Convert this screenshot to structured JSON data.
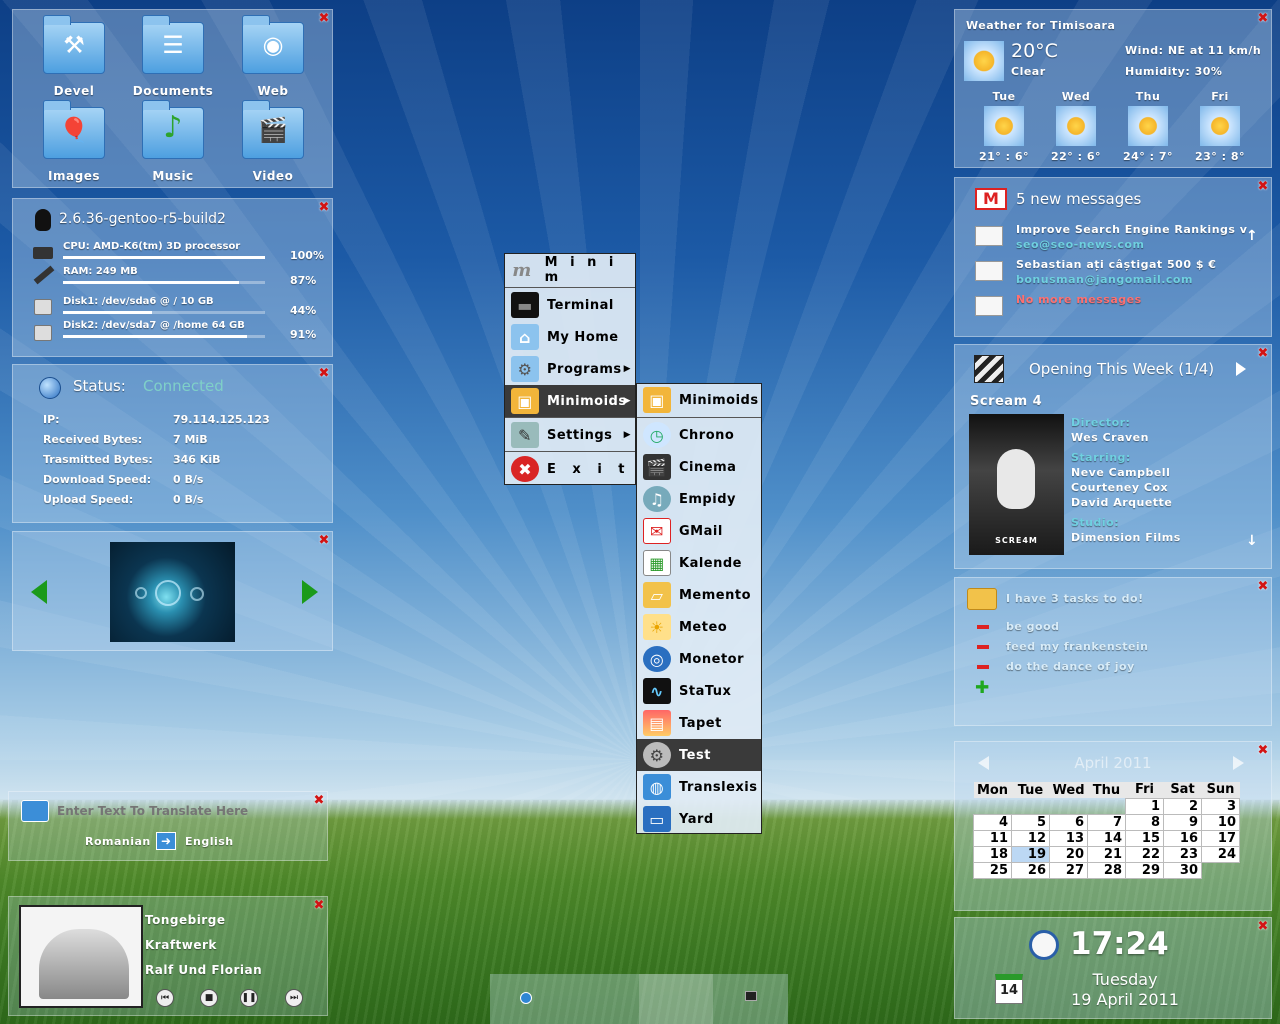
{
  "folders": [
    {
      "label": "Devel",
      "icon": "hammer-icon",
      "glyph": "⚒"
    },
    {
      "label": "Documents",
      "icon": "documents-icon",
      "glyph": "☰"
    },
    {
      "label": "Web",
      "icon": "web-icon",
      "glyph": "◉"
    },
    {
      "label": "Images",
      "icon": "images-icon",
      "glyph": "🎈"
    },
    {
      "label": "Music",
      "icon": "music-note-icon",
      "glyph": "♪"
    },
    {
      "label": "Video",
      "icon": "clapperboard-icon",
      "glyph": "🎬"
    }
  ],
  "sysinfo": {
    "kernel": "2.6.36-gentoo-r5-build2",
    "rows": [
      {
        "label": "CPU: AMD-K6(tm) 3D processor",
        "pct": "100%",
        "fill": 1.0,
        "icon": "cpu-icon"
      },
      {
        "label": "RAM: 249 MB",
        "pct": "87%",
        "fill": 0.87,
        "icon": "ram-icon"
      },
      {
        "label": "Disk1: /dev/sda6 @ / 10 GB",
        "pct": "44%",
        "fill": 0.44,
        "icon": "disk-icon"
      },
      {
        "label": "Disk2: /dev/sda7 @ /home 64 GB",
        "pct": "91%",
        "fill": 0.91,
        "icon": "disk-icon"
      }
    ]
  },
  "network": {
    "status_label": "Status:",
    "status_value": "Connected",
    "rows": [
      {
        "k": "IP:",
        "v": "79.114.125.123"
      },
      {
        "k": "Received Bytes:",
        "v": "7 MiB"
      },
      {
        "k": "Trasmitted Bytes:",
        "v": "346 KiB"
      },
      {
        "k": "Download Speed:",
        "v": "0 B/s"
      },
      {
        "k": "Upload Speed:",
        "v": "0 B/s"
      }
    ]
  },
  "translator": {
    "placeholder": "Enter Text To Translate Here",
    "from": "Romanian",
    "to": "English"
  },
  "player": {
    "title": "Tongebirge",
    "artist": "Kraftwerk",
    "album": "Ralf Und Florian"
  },
  "menu": {
    "title": "M i n i m",
    "items": [
      {
        "label": "Terminal",
        "icon": "terminal-icon",
        "glyph": "▬"
      },
      {
        "label": "My Home",
        "icon": "home-icon",
        "glyph": "⌂"
      },
      {
        "label": "Programs",
        "icon": "programs-icon",
        "glyph": "⚙"
      },
      {
        "label": "Minimoids",
        "icon": "minimoids-icon",
        "glyph": "▣"
      },
      {
        "label": "Settings",
        "icon": "settings-icon",
        "glyph": "✎"
      },
      {
        "label": "E x i t",
        "icon": "exit-icon",
        "glyph": "✖"
      }
    ],
    "submenu_title": "Minimoids",
    "submenu": [
      {
        "label": "Chrono",
        "icon": "chrono-icon",
        "glyph": "◷"
      },
      {
        "label": "Cinema",
        "icon": "cinema-icon",
        "glyph": "🎬"
      },
      {
        "label": "Empidy",
        "icon": "empidy-icon",
        "glyph": "♫"
      },
      {
        "label": "GMail",
        "icon": "gmail-icon",
        "glyph": "✉"
      },
      {
        "label": "Kalende",
        "icon": "calendar-icon",
        "glyph": "▦"
      },
      {
        "label": "Memento",
        "icon": "memento-icon",
        "glyph": "▱"
      },
      {
        "label": "Meteo",
        "icon": "meteo-icon",
        "glyph": "☀"
      },
      {
        "label": "Monetor",
        "icon": "monetor-icon",
        "glyph": "◎"
      },
      {
        "label": "StaTux",
        "icon": "statux-icon",
        "glyph": "∿"
      },
      {
        "label": "Tapet",
        "icon": "tapet-icon",
        "glyph": "▤"
      },
      {
        "label": "Test",
        "icon": "gear-icon",
        "glyph": "⚙"
      },
      {
        "label": "Translexis",
        "icon": "translexis-icon",
        "glyph": "◍"
      },
      {
        "label": "Yard",
        "icon": "yard-icon",
        "glyph": "▭"
      }
    ]
  },
  "weather": {
    "title": "Weather for Timisoara",
    "temp": "20°C",
    "cond": "Clear",
    "wind": "Wind: NE at 11 km/h",
    "humidity": "Humidity: 30%",
    "days": [
      {
        "day": "Tue",
        "range": "21° : 6°",
        "icon": "sun-icon"
      },
      {
        "day": "Wed",
        "range": "22° : 6°",
        "icon": "sun-icon"
      },
      {
        "day": "Thu",
        "range": "24° : 7°",
        "icon": "sun-icon"
      },
      {
        "day": "Fri",
        "range": "23° : 8°",
        "icon": "partly-cloudy-icon"
      }
    ]
  },
  "mail": {
    "header": "5 new messages",
    "messages": [
      {
        "subject": "Improve Search Engine Rankings v",
        "from": "seo@seo-news.com"
      },
      {
        "subject": "Sebastian ați câștigat 500 $ €",
        "from": "bonusman@jangomail.com"
      }
    ],
    "none": "No more messages"
  },
  "cinema": {
    "header": "Opening This Week (1/4)",
    "movie": "Scream 4",
    "director_label": "Director:",
    "director": "Wes Craven",
    "starring_label": "Starring:",
    "cast": [
      "Neve Campbell",
      "Courteney Cox",
      "David Arquette"
    ],
    "studio_label": "Studio:",
    "studio": "Dimension Films",
    "poster_text": "SCRE4M"
  },
  "todo": {
    "header": "I have 3 tasks to do!",
    "tasks": [
      "be good",
      "feed my frankenstein",
      "do the dance of joy"
    ]
  },
  "calendar": {
    "month": "April 2011",
    "weekdays": [
      "Mon",
      "Tue",
      "Wed",
      "Thu",
      "Fri",
      "Sat",
      "Sun"
    ],
    "weeks": [
      [
        "",
        "",
        "",
        "",
        "1",
        "2",
        "3"
      ],
      [
        "4",
        "5",
        "6",
        "7",
        "8",
        "9",
        "10"
      ],
      [
        "11",
        "12",
        "13",
        "14",
        "15",
        "16",
        "17"
      ],
      [
        "18",
        "19",
        "20",
        "21",
        "22",
        "23",
        "24"
      ],
      [
        "25",
        "26",
        "27",
        "28",
        "29",
        "30",
        ""
      ]
    ],
    "today": "19"
  },
  "clock": {
    "time": "17:24",
    "weekday": "Tuesday",
    "date": "19 April 2011",
    "cal_day": "14"
  },
  "colors": {
    "connected": "#7fd0c8",
    "mail_from": "#6fd0e0",
    "nomail": "#ff7070",
    "cinema_label": "#6fd0e0",
    "todo_text": "#d8ecf8"
  }
}
